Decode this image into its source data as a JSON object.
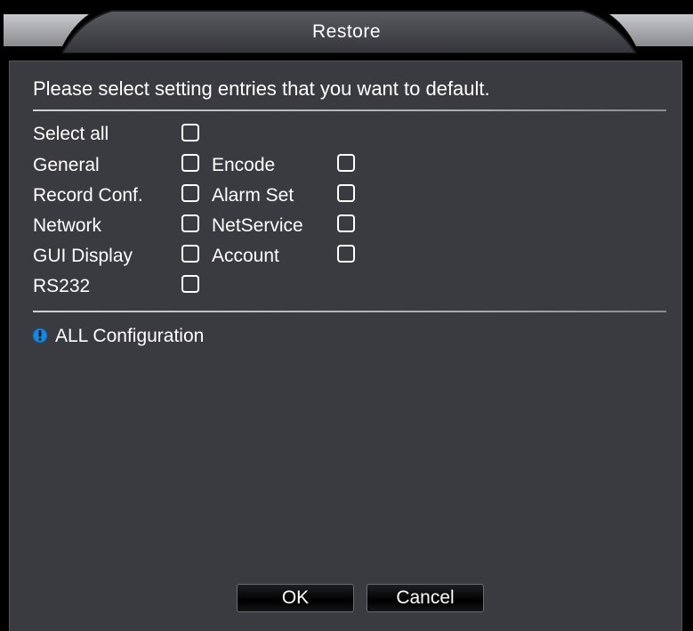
{
  "window": {
    "title": "Restore"
  },
  "instruction": "Please select setting entries that you want to default.",
  "options": {
    "select_all": "Select all",
    "general": "General",
    "encode": "Encode",
    "record_conf": "Record Conf.",
    "alarm_set": "Alarm Set",
    "network": "Network",
    "net_service": "NetService",
    "gui_display": "GUI Display",
    "account": "Account",
    "rs232": "RS232"
  },
  "checked": {
    "select_all": false,
    "general": false,
    "encode": false,
    "record_conf": false,
    "alarm_set": false,
    "network": false,
    "net_service": false,
    "gui_display": false,
    "account": false,
    "rs232": false
  },
  "info": {
    "text": "ALL Configuration",
    "icon": "info-icon"
  },
  "buttons": {
    "ok": "OK",
    "cancel": "Cancel"
  },
  "colors": {
    "panel_bg": "#3a3b40",
    "title_bar": "#46474c",
    "text": "#ffffff",
    "info_icon": "#1e86d8"
  }
}
